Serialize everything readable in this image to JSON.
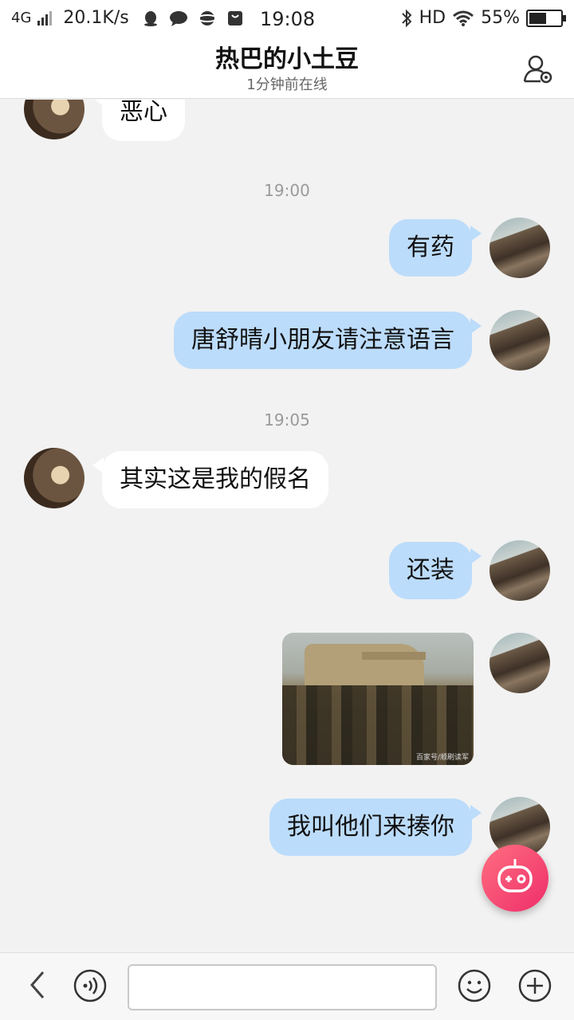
{
  "status_bar": {
    "network": "4G",
    "speed": "20.1K/s",
    "time": "19:08",
    "hd": "HD",
    "battery": "55%",
    "battery_level": 0.55
  },
  "header": {
    "title": "热巴的小土豆",
    "subtitle": "1分钟前在线",
    "contact_icon": "user-settings-icon"
  },
  "messages": [
    {
      "side": "in",
      "text": "恶心"
    },
    {
      "timestamp": "19:00"
    },
    {
      "side": "out",
      "text": "有药"
    },
    {
      "side": "out",
      "text": "唐舒晴小朋友请注意语言"
    },
    {
      "timestamp": "19:05"
    },
    {
      "side": "in",
      "text": "其实这是我的假名"
    },
    {
      "side": "out",
      "text": "还装"
    },
    {
      "side": "out",
      "type": "image",
      "caption": "百家号/顺刷读军"
    },
    {
      "side": "out",
      "text": "我叫他们来揍你"
    }
  ],
  "input_bar": {
    "placeholder": "",
    "icons": [
      "back-arrow-icon",
      "voice-icon",
      "emoji-icon",
      "plus-icon"
    ]
  },
  "floating_button": {
    "icon": "robot-icon",
    "color": "#ee2d6a"
  },
  "colors": {
    "outgoing_bubble": "#bcdcfb",
    "incoming_bubble": "#ffffff",
    "background": "#f2f2f2"
  }
}
